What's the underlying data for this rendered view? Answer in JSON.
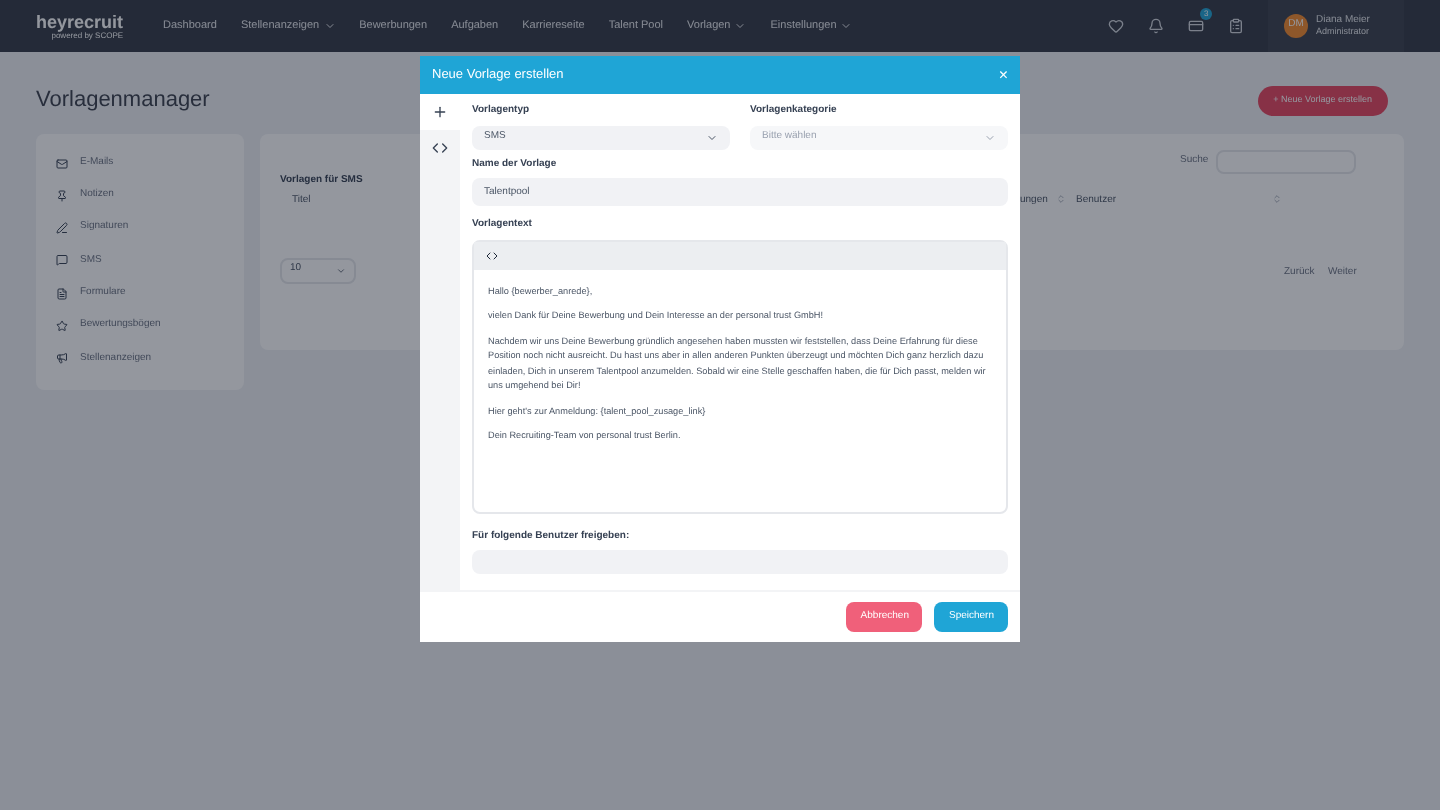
{
  "navbar": {
    "logo": "heyrecruit",
    "logo_sub": "powered by SCOPE",
    "items": [
      {
        "label": "Dashboard",
        "dropdown": false
      },
      {
        "label": "Stellenanzeigen",
        "dropdown": true
      },
      {
        "label": "Bewerbungen",
        "dropdown": false
      },
      {
        "label": "Aufgaben",
        "dropdown": false
      },
      {
        "label": "Karriereseite",
        "dropdown": false
      },
      {
        "label": "Talent Pool",
        "dropdown": false
      },
      {
        "label": "Vorlagen",
        "dropdown": true
      },
      {
        "label": "Einstellungen",
        "dropdown": true
      }
    ],
    "badge": "3",
    "user": {
      "initials": "DM",
      "name": "Diana Meier",
      "role": "Administrator"
    }
  },
  "page": {
    "title": "Vorlagenmanager",
    "new_button": "+ Neue Vorlage erstellen",
    "sidebar": [
      {
        "label": "E-Mails",
        "kind": "mail"
      },
      {
        "label": "Notizen",
        "kind": "pin"
      },
      {
        "label": "Signaturen",
        "kind": "sign"
      },
      {
        "label": "SMS",
        "kind": "sms"
      },
      {
        "label": "Formulare",
        "kind": "form"
      },
      {
        "label": "Bewertungsbögen",
        "kind": "star"
      },
      {
        "label": "Stellenanzeigen",
        "kind": "megaphone"
      }
    ],
    "list": {
      "title": "Vorlagen für SMS",
      "search_label": "Suche",
      "columns": [
        "Titel",
        "ungen",
        "Benutzer"
      ],
      "page_size": "10",
      "prev": "Zurück",
      "next": "Weiter"
    }
  },
  "modal": {
    "title": "Neue Vorlage erstellen",
    "close": "×",
    "type": {
      "label": "Vorlagentyp",
      "value": "SMS"
    },
    "category": {
      "label": "Vorlagenkategorie",
      "placeholder": "Bitte wählen",
      "disabled": true
    },
    "name": {
      "label": "Name der Vorlage",
      "value": "Talentpool"
    },
    "text": {
      "label": "Vorlagentext",
      "paragraphs": [
        "Hallo {bewerber_anrede},",
        "vielen Dank für Deine Bewerbung und Dein Interesse an der personal trust GmbH!",
        "Nachdem wir uns Deine Bewerbung gründlich angesehen haben mussten wir feststellen, dass Deine Erfahrung für diese Position noch nicht ausreicht. Du hast uns aber in allen anderen Punkten überzeugt und möchten Dich ganz herzlich dazu einladen, Dich in unserem Talentpool anzumelden. Sobald wir eine Stelle geschaffen haben, die für Dich passt, melden wir uns umgehend bei Dir!",
        "Hier geht's zur Anmeldung: {talent_pool_zusage_link}",
        "Dein Recruiting-Team von personal trust Berlin."
      ]
    },
    "share": {
      "label": "Für folgende Benutzer freigeben:"
    },
    "cancel": "Abbrechen",
    "save": "Speichern"
  }
}
